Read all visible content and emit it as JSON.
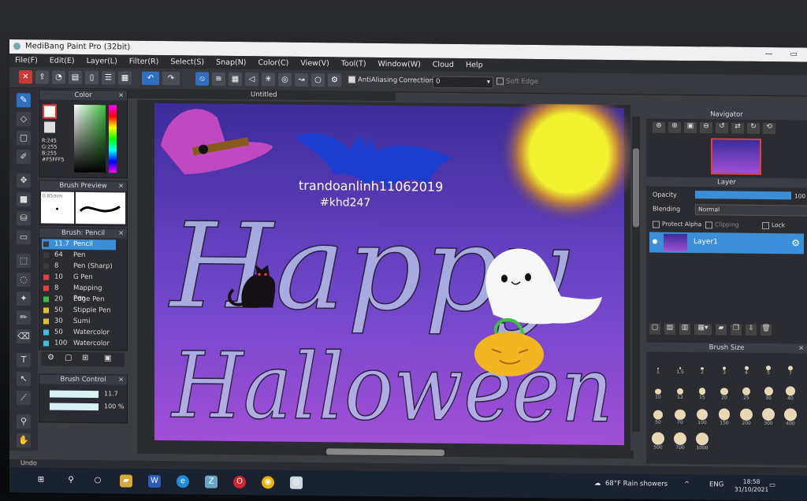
{
  "window": {
    "title": "MediBang Paint Pro (32bit)",
    "min": "—",
    "max": "▭"
  },
  "menu": [
    "File(F)",
    "Edit(E)",
    "Layer(L)",
    "Filter(R)",
    "Select(S)",
    "Snap(N)",
    "Color(C)",
    "View(V)",
    "Tool(T)",
    "Window(W)",
    "Cloud",
    "Help"
  ],
  "toolbar": {
    "antialiasing": "AntiAliasing",
    "correction_label": "Correction",
    "correction_value": "0",
    "soft_edge": "Soft Edge"
  },
  "document": {
    "tab": "Untitled"
  },
  "color_panel": {
    "title": "Color",
    "r": "R:245",
    "g": "G:255",
    "b": "B:255",
    "hex": "#F5FFF5"
  },
  "brush_preview": {
    "title": "Brush Preview",
    "size": "0.85mm"
  },
  "brush_panel": {
    "title": "Brush: Pencil",
    "items": [
      {
        "size": "11.7",
        "name": "Pencil",
        "color": "#3a3a3a"
      },
      {
        "size": "64",
        "name": "Pen",
        "color": "#3a3a3a"
      },
      {
        "size": "8",
        "name": "Pen (Sharp)",
        "color": "#3a3a3a"
      },
      {
        "size": "10",
        "name": "G Pen",
        "color": "#e04040"
      },
      {
        "size": "8",
        "name": "Mapping Pen",
        "color": "#e04040"
      },
      {
        "size": "20",
        "name": "Edge Pen",
        "color": "#3fbf3f"
      },
      {
        "size": "50",
        "name": "Stipple Pen",
        "color": "#e0c030"
      },
      {
        "size": "30",
        "name": "Sumi",
        "color": "#e0c030"
      },
      {
        "size": "50",
        "name": "Watercolor",
        "color": "#40c0e0"
      },
      {
        "size": "100",
        "name": "Watercolor",
        "color": "#40c0e0"
      }
    ]
  },
  "brush_control": {
    "title": "Brush Control",
    "size": "11.7",
    "opacity": "100 %"
  },
  "canvas_art": {
    "text1": "Happy",
    "text2": "Halloween",
    "signature1": "trandoanlinh11062019",
    "signature2": "#khd247"
  },
  "navigator": {
    "title": "Navigator"
  },
  "layer_panel": {
    "title": "Layer",
    "opacity_label": "Opacity",
    "opacity_value": "100",
    "blending_label": "Blending",
    "blending_value": "Normal",
    "protect_alpha": "Protect Alpha",
    "clipping": "Clipping",
    "lock": "Lock",
    "layer_name": "Layer1"
  },
  "brush_size_panel": {
    "title": "Brush Size",
    "rows": [
      [
        "1",
        "1.5",
        "2",
        "3",
        "4",
        "5",
        "7"
      ],
      [
        "10",
        "12",
        "15",
        "20",
        "25",
        "30",
        "40"
      ],
      [
        "50",
        "70",
        "100",
        "150",
        "200",
        "300",
        "400"
      ],
      [
        "500",
        "700",
        "1000"
      ]
    ]
  },
  "status": {
    "text": "Undo"
  },
  "taskbar": {
    "weather": "68°F Rain showers",
    "lang": "ENG",
    "time": "18:58",
    "date": "31/10/2021"
  },
  "colors": {
    "accent": "#2f6fc0",
    "layer_selected": "#3b8fd9",
    "sky_top": "#3c2c9a",
    "sky_bottom": "#a14fd6",
    "moon": "#f3f230"
  }
}
